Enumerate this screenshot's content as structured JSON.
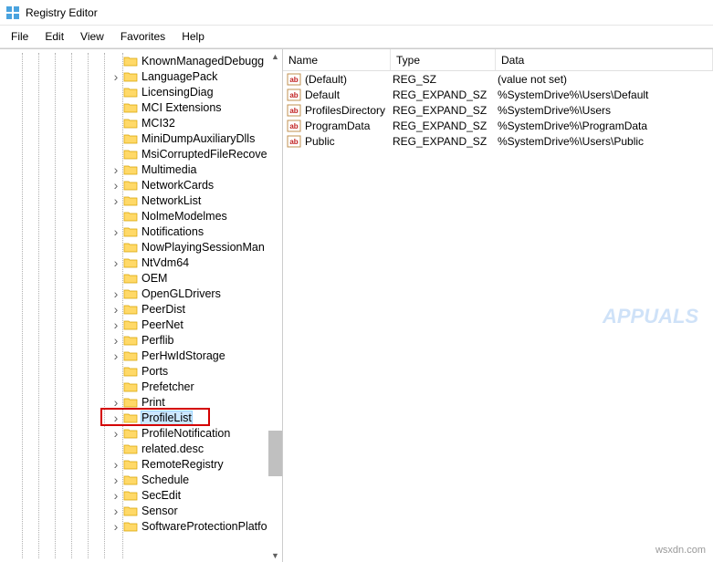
{
  "window": {
    "title": "Registry Editor"
  },
  "menu": {
    "file": "File",
    "edit": "Edit",
    "view": "View",
    "favorites": "Favorites",
    "help": "Help"
  },
  "columns": {
    "name": "Name",
    "type": "Type",
    "data": "Data"
  },
  "tree": [
    {
      "label": "KnownManagedDebugg",
      "expandable": false
    },
    {
      "label": "LanguagePack",
      "expandable": true
    },
    {
      "label": "LicensingDiag",
      "expandable": false
    },
    {
      "label": "MCI Extensions",
      "expandable": false
    },
    {
      "label": "MCI32",
      "expandable": false
    },
    {
      "label": "MiniDumpAuxiliaryDlls",
      "expandable": false
    },
    {
      "label": "MsiCorruptedFileRecove",
      "expandable": false
    },
    {
      "label": "Multimedia",
      "expandable": true
    },
    {
      "label": "NetworkCards",
      "expandable": true
    },
    {
      "label": "NetworkList",
      "expandable": true
    },
    {
      "label": "NolmeModelmes",
      "expandable": false
    },
    {
      "label": "Notifications",
      "expandable": true
    },
    {
      "label": "NowPlayingSessionMan",
      "expandable": false
    },
    {
      "label": "NtVdm64",
      "expandable": true
    },
    {
      "label": "OEM",
      "expandable": false
    },
    {
      "label": "OpenGLDrivers",
      "expandable": true
    },
    {
      "label": "PeerDist",
      "expandable": true
    },
    {
      "label": "PeerNet",
      "expandable": true
    },
    {
      "label": "Perflib",
      "expandable": true
    },
    {
      "label": "PerHwIdStorage",
      "expandable": true
    },
    {
      "label": "Ports",
      "expandable": false
    },
    {
      "label": "Prefetcher",
      "expandable": false
    },
    {
      "label": "Print",
      "expandable": true
    },
    {
      "label": "ProfileList",
      "expandable": true,
      "selected": true,
      "highlighted": true
    },
    {
      "label": "ProfileNotification",
      "expandable": true
    },
    {
      "label": "related.desc",
      "expandable": false
    },
    {
      "label": "RemoteRegistry",
      "expandable": true
    },
    {
      "label": "Schedule",
      "expandable": true
    },
    {
      "label": "SecEdit",
      "expandable": true
    },
    {
      "label": "Sensor",
      "expandable": true
    },
    {
      "label": "SoftwareProtectionPlatfo",
      "expandable": true
    }
  ],
  "values": [
    {
      "name": "(Default)",
      "type": "REG_SZ",
      "data": "(value not set)"
    },
    {
      "name": "Default",
      "type": "REG_EXPAND_SZ",
      "data": "%SystemDrive%\\Users\\Default"
    },
    {
      "name": "ProfilesDirectory",
      "type": "REG_EXPAND_SZ",
      "data": "%SystemDrive%\\Users"
    },
    {
      "name": "ProgramData",
      "type": "REG_EXPAND_SZ",
      "data": "%SystemDrive%\\ProgramData"
    },
    {
      "name": "Public",
      "type": "REG_EXPAND_SZ",
      "data": "%SystemDrive%\\Users\\Public"
    }
  ],
  "watermark": "wsxdn.com",
  "appuals_watermark": "APPUALS"
}
